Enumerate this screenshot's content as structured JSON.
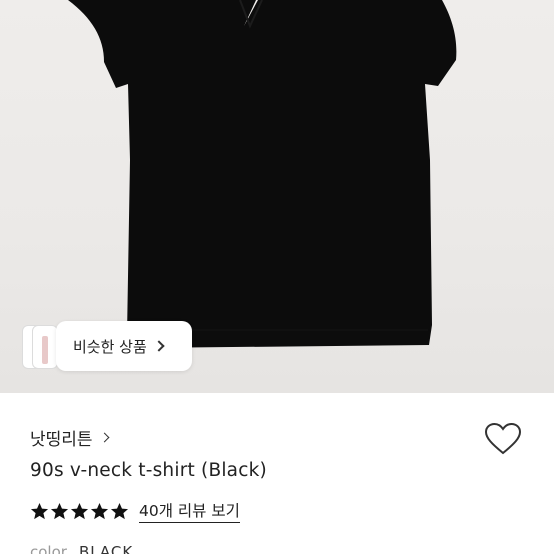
{
  "product_image": {
    "similar_button_label": "비슷한 상품",
    "shirt_color": "#0c0c0c",
    "background_color": "#ebe9e7"
  },
  "shop": {
    "name": "낫띵리튼"
  },
  "product": {
    "title": "90s v-neck t-shirt (Black)",
    "rating_stars": 5,
    "rating_max": 5,
    "reviews_label": "40개 리뷰 보기",
    "color_label": "color",
    "color_value": "BLACK"
  },
  "icons": {
    "heart": "heart-outline-icon",
    "star": "star-filled-icon",
    "chevron": "chevron-right-icon"
  }
}
